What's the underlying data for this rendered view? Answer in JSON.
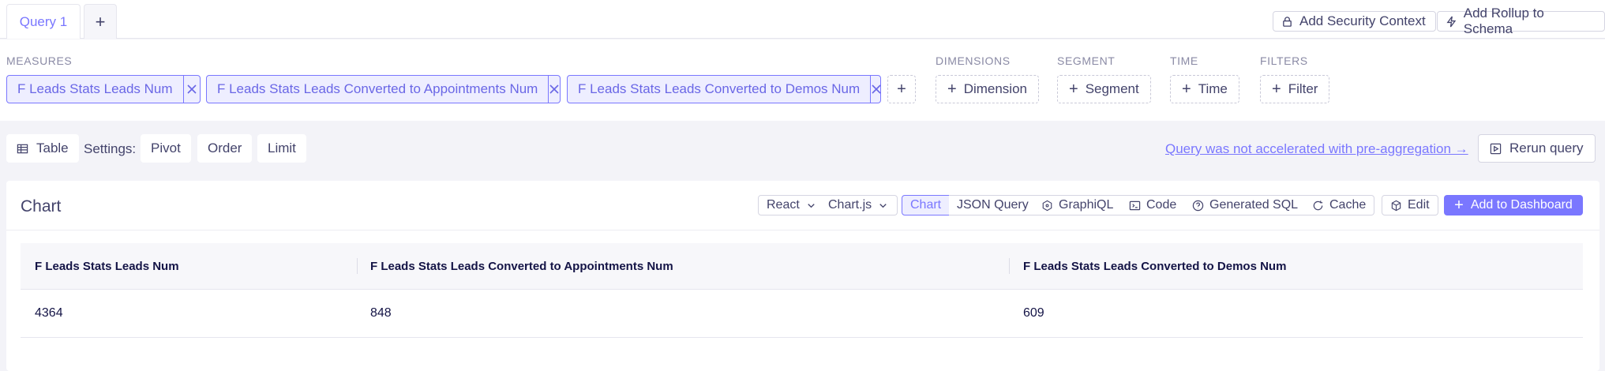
{
  "tabs": {
    "active_label": "Query 1",
    "add_label": "+"
  },
  "top_actions": {
    "security_label": "Add Security Context",
    "rollup_label": "Add Rollup to Schema"
  },
  "sections": {
    "measures": "MEASURES",
    "dimensions": "DIMENSIONS",
    "segment": "SEGMENT",
    "time": "TIME",
    "filters": "FILTERS"
  },
  "measures": [
    {
      "label": "F Leads Stats Leads Num"
    },
    {
      "label": "F Leads Stats Leads Converted to Appointments Num"
    },
    {
      "label": "F Leads Stats Leads Converted to Demos Num"
    }
  ],
  "member_buttons": {
    "dimension": "Dimension",
    "segment": "Segment",
    "time": "Time",
    "filter": "Filter",
    "add": "+"
  },
  "settings": {
    "table_label": "Table",
    "settings_label": "Settings:",
    "pivot": "Pivot",
    "order": "Order",
    "limit": "Limit",
    "preagg_link": "Query was not accelerated with pre-aggregation →",
    "rerun": "Rerun query"
  },
  "card": {
    "title": "Chart",
    "framework": "React",
    "library": "Chart.js",
    "tabs": [
      "Chart",
      "JSON Query",
      "GraphiQL",
      "Code",
      "Generated SQL",
      "Cache"
    ],
    "edit": "Edit",
    "add_dashboard": "Add to Dashboard"
  },
  "table": {
    "columns": [
      "F Leads Stats Leads Num",
      "F Leads Stats Leads Converted to Appointments Num",
      "F Leads Stats Leads Converted to Demos Num"
    ],
    "rows": [
      [
        "4364",
        "848",
        "609"
      ]
    ]
  },
  "colors": {
    "accent": "#7a77ff",
    "text": "#141446",
    "muted": "#43436b",
    "background": "#f3f3f8"
  }
}
